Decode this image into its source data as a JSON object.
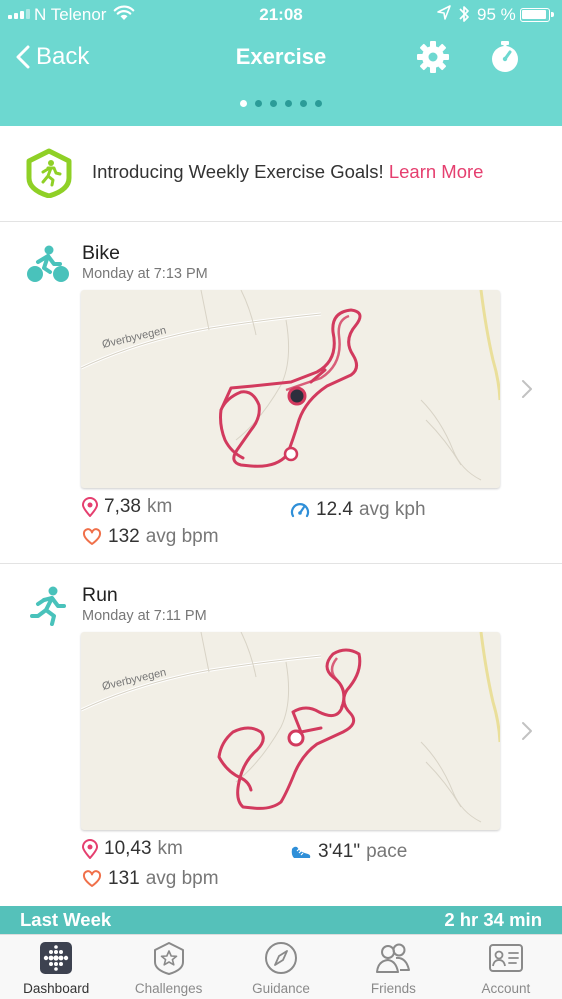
{
  "status_bar": {
    "carrier": "N Telenor",
    "time": "21:08",
    "battery": "95 %"
  },
  "header": {
    "back_label": "Back",
    "title": "Exercise",
    "page_count": 6,
    "active_page": 1
  },
  "banner": {
    "text": "Introducing Weekly Exercise Goals!",
    "link": "Learn More"
  },
  "exercises": [
    {
      "activity": "Bike",
      "time": "Monday at 7:13 PM",
      "map_road_label": "Øverbyvegen",
      "distance_value": "7,38",
      "distance_unit": "km",
      "speed_value": "12.4",
      "speed_unit": "avg kph",
      "heart_value": "132",
      "heart_unit": "avg bpm"
    },
    {
      "activity": "Run",
      "time": "Monday at 7:11 PM",
      "map_road_label": "Øverbyvegen",
      "distance_value": "10,43",
      "distance_unit": "km",
      "pace_value": "3'41\"",
      "pace_unit": "pace",
      "heart_value": "131",
      "heart_unit": "avg bpm"
    }
  ],
  "last_week": {
    "label": "Last Week",
    "value": "2 hr 34 min"
  },
  "tabs": [
    {
      "label": "Dashboard",
      "icon": "dashboard-icon",
      "active": true
    },
    {
      "label": "Challenges",
      "icon": "challenges-icon",
      "active": false
    },
    {
      "label": "Guidance",
      "icon": "compass-icon",
      "active": false
    },
    {
      "label": "Friends",
      "icon": "friends-icon",
      "active": false
    },
    {
      "label": "Account",
      "icon": "account-card-icon",
      "active": false
    }
  ],
  "colors": {
    "header": "#6dd8d0",
    "accent_pink": "#e53f6f",
    "route": "#d23a5e",
    "teal_icon": "#49c2bb",
    "badge_green": "#8fd026",
    "last_week_bar": "#55c1ba"
  }
}
